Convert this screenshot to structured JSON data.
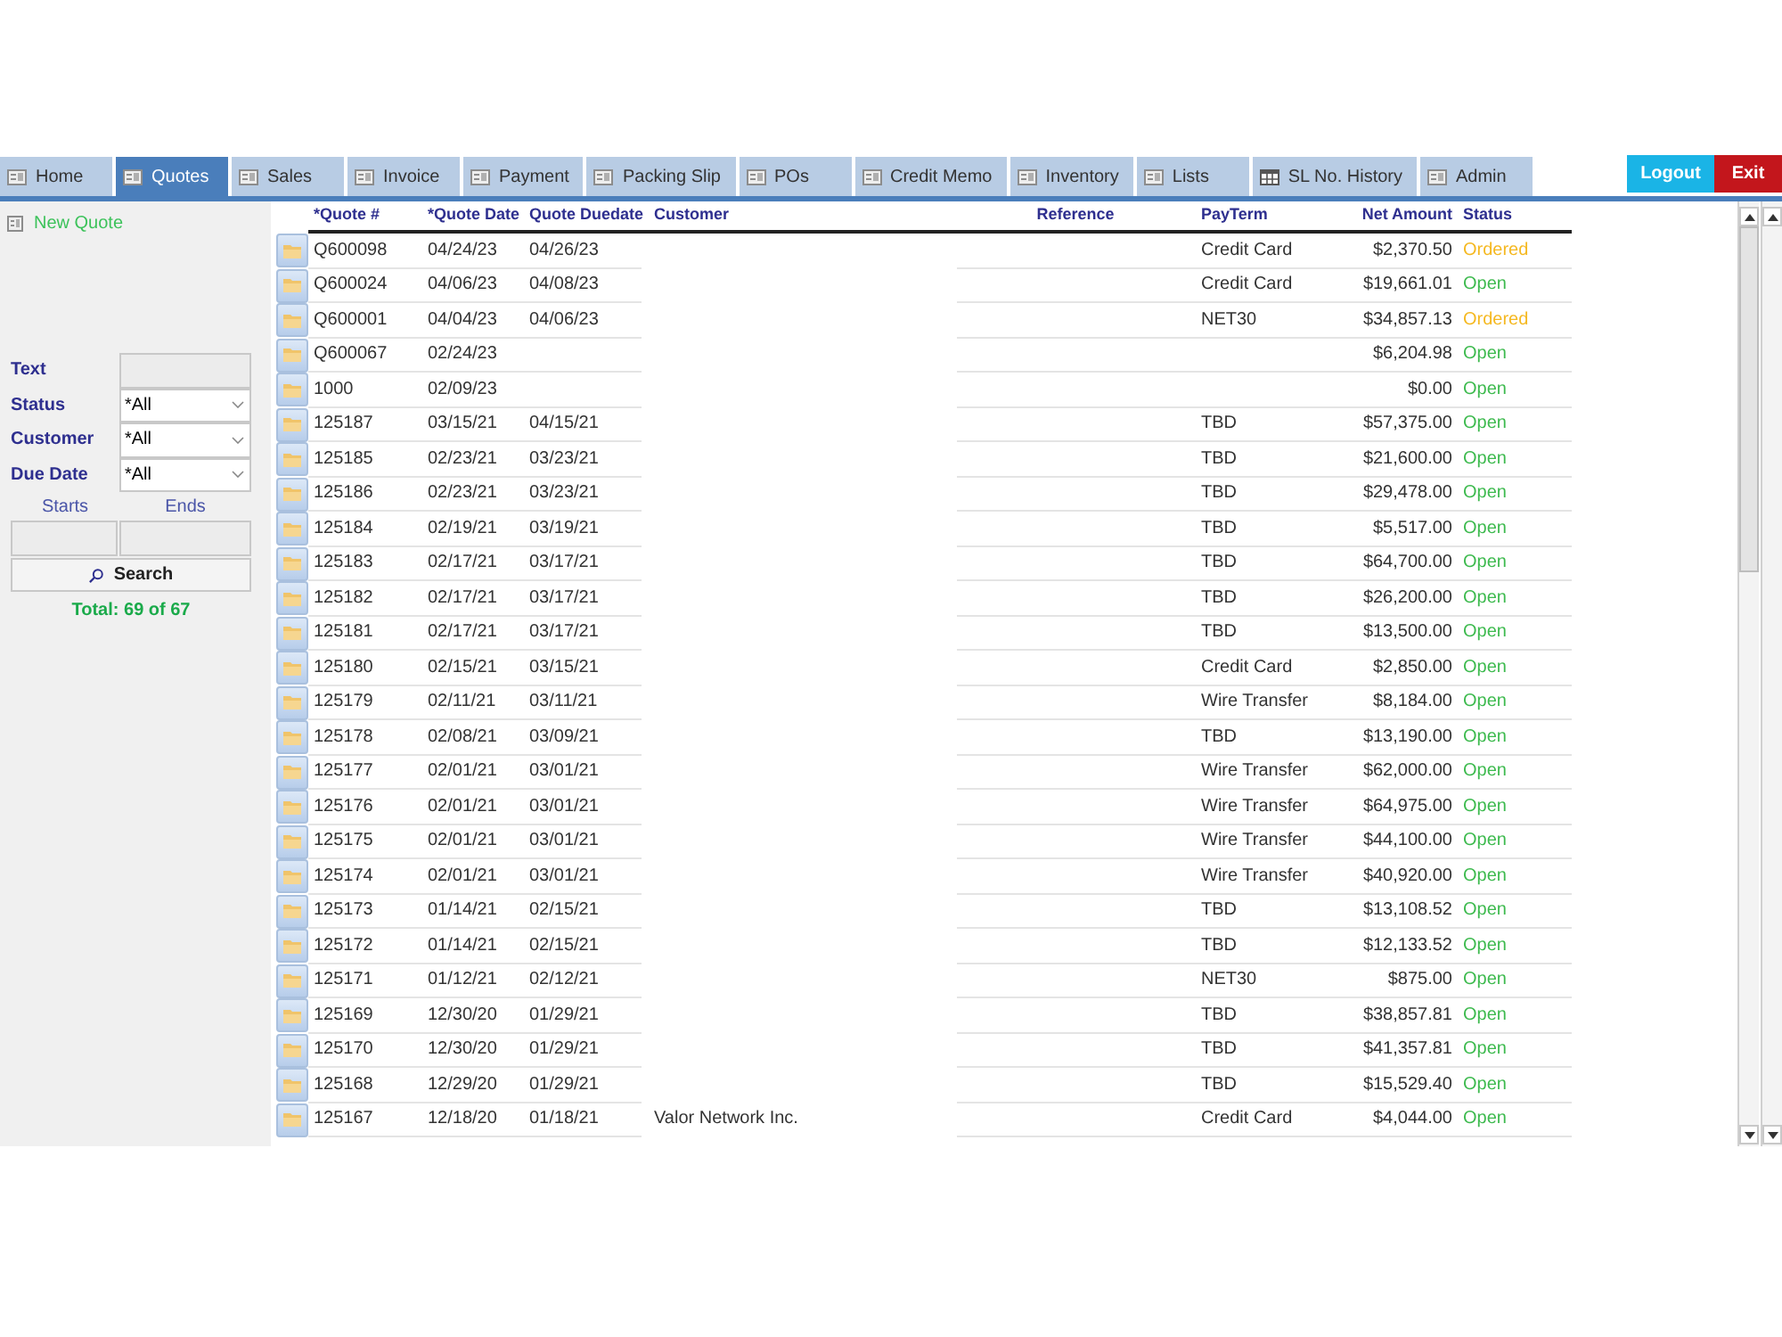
{
  "tabs": [
    {
      "label": "Home",
      "kind": "form",
      "selected": false
    },
    {
      "label": "Quotes",
      "kind": "form",
      "selected": true
    },
    {
      "label": "Sales",
      "kind": "form",
      "selected": false
    },
    {
      "label": "Invoice",
      "kind": "form",
      "selected": false
    },
    {
      "label": "Payment",
      "kind": "form",
      "selected": false
    },
    {
      "label": "Packing Slip",
      "kind": "form",
      "selected": false
    },
    {
      "label": "POs",
      "kind": "form",
      "selected": false
    },
    {
      "label": "Credit Memo",
      "kind": "form",
      "selected": false
    },
    {
      "label": "Inventory",
      "kind": "form",
      "selected": false
    },
    {
      "label": "Lists",
      "kind": "form",
      "selected": false
    },
    {
      "label": "SL No. History",
      "kind": "table",
      "selected": false
    },
    {
      "label": "Admin",
      "kind": "form",
      "selected": false
    }
  ],
  "header_buttons": {
    "logout": "Logout",
    "exit": "Exit"
  },
  "sidebar": {
    "new_quote": "New Quote",
    "filters": [
      {
        "label": "Text",
        "kind": "text"
      },
      {
        "label": "Status",
        "kind": "select",
        "value": "*All"
      },
      {
        "label": "Customer",
        "kind": "select",
        "value": "*All"
      },
      {
        "label": "Due Date",
        "kind": "select",
        "value": "*All"
      }
    ],
    "date_range": {
      "start_label": "Starts",
      "end_label": "Ends"
    },
    "search_button": "Search",
    "total": "Total: 69 of 67"
  },
  "table": {
    "columns": [
      "*Quote #",
      "*Quote Date",
      "Quote Duedate",
      "Customer",
      "Reference",
      "PayTerm",
      "Net Amount",
      "Status"
    ],
    "rows": [
      {
        "quote_no": "Q600098",
        "quote_date": "04/24/23",
        "due_date": "04/26/23",
        "pay_term": "Credit Card",
        "net_amount": "$2,370.50",
        "status": "Ordered",
        "color": "#f5b820"
      },
      {
        "quote_no": "Q600024",
        "quote_date": "04/06/23",
        "due_date": "04/08/23",
        "pay_term": "Credit Card",
        "net_amount": "$19,661.01",
        "status": "Open",
        "color": "#3dba4e"
      },
      {
        "quote_no": "Q600001",
        "quote_date": "04/04/23",
        "due_date": "04/06/23",
        "pay_term": "NET30",
        "net_amount": "$34,857.13",
        "status": "Ordered",
        "color": "#f5b820"
      },
      {
        "quote_no": "Q600067",
        "quote_date": "02/24/23",
        "net_amount": "$6,204.98",
        "status": "Open",
        "color": "#3dba4e"
      },
      {
        "quote_no": "1000",
        "quote_date": "02/09/23",
        "net_amount": "$0.00",
        "status": "Open",
        "color": "#3dba4e"
      },
      {
        "quote_no": "125187",
        "quote_date": "03/15/21",
        "due_date": "04/15/21",
        "pay_term": "TBD",
        "net_amount": "$57,375.00",
        "status": "Open",
        "color": "#3dba4e"
      },
      {
        "quote_no": "125185",
        "quote_date": "02/23/21",
        "due_date": "03/23/21",
        "pay_term": "TBD",
        "net_amount": "$21,600.00",
        "status": "Open",
        "color": "#3dba4e"
      },
      {
        "quote_no": "125186",
        "quote_date": "02/23/21",
        "due_date": "03/23/21",
        "pay_term": "TBD",
        "net_amount": "$29,478.00",
        "status": "Open",
        "color": "#3dba4e"
      },
      {
        "quote_no": "125184",
        "quote_date": "02/19/21",
        "due_date": "03/19/21",
        "pay_term": "TBD",
        "net_amount": "$5,517.00",
        "status": "Open",
        "color": "#3dba4e"
      },
      {
        "quote_no": "125183",
        "quote_date": "02/17/21",
        "due_date": "03/17/21",
        "pay_term": "TBD",
        "net_amount": "$64,700.00",
        "status": "Open",
        "color": "#3dba4e"
      },
      {
        "quote_no": "125182",
        "quote_date": "02/17/21",
        "due_date": "03/17/21",
        "pay_term": "TBD",
        "net_amount": "$26,200.00",
        "status": "Open",
        "color": "#3dba4e"
      },
      {
        "quote_no": "125181",
        "quote_date": "02/17/21",
        "due_date": "03/17/21",
        "pay_term": "TBD",
        "net_amount": "$13,500.00",
        "status": "Open",
        "color": "#3dba4e"
      },
      {
        "quote_no": "125180",
        "quote_date": "02/15/21",
        "due_date": "03/15/21",
        "pay_term": "Credit Card",
        "net_amount": "$2,850.00",
        "status": "Open",
        "color": "#3dba4e"
      },
      {
        "quote_no": "125179",
        "quote_date": "02/11/21",
        "due_date": "03/11/21",
        "pay_term": "Wire Transfer",
        "net_amount": "$8,184.00",
        "status": "Open",
        "color": "#3dba4e"
      },
      {
        "quote_no": "125178",
        "quote_date": "02/08/21",
        "due_date": "03/09/21",
        "pay_term": "TBD",
        "net_amount": "$13,190.00",
        "status": "Open",
        "color": "#3dba4e"
      },
      {
        "quote_no": "125177",
        "quote_date": "02/01/21",
        "due_date": "03/01/21",
        "pay_term": "Wire Transfer",
        "net_amount": "$62,000.00",
        "status": "Open",
        "color": "#3dba4e"
      },
      {
        "quote_no": "125176",
        "quote_date": "02/01/21",
        "due_date": "03/01/21",
        "pay_term": "Wire Transfer",
        "net_amount": "$64,975.00",
        "status": "Open",
        "color": "#3dba4e"
      },
      {
        "quote_no": "125175",
        "quote_date": "02/01/21",
        "due_date": "03/01/21",
        "pay_term": "Wire Transfer",
        "net_amount": "$44,100.00",
        "status": "Open",
        "color": "#3dba4e"
      },
      {
        "quote_no": "125174",
        "quote_date": "02/01/21",
        "due_date": "03/01/21",
        "pay_term": "Wire Transfer",
        "net_amount": "$40,920.00",
        "status": "Open",
        "color": "#3dba4e"
      },
      {
        "quote_no": "125173",
        "quote_date": "01/14/21",
        "due_date": "02/15/21",
        "pay_term": "TBD",
        "net_amount": "$13,108.52",
        "status": "Open",
        "color": "#3dba4e"
      },
      {
        "quote_no": "125172",
        "quote_date": "01/14/21",
        "due_date": "02/15/21",
        "pay_term": "TBD",
        "net_amount": "$12,133.52",
        "status": "Open",
        "color": "#3dba4e"
      },
      {
        "quote_no": "125171",
        "quote_date": "01/12/21",
        "due_date": "02/12/21",
        "pay_term": "NET30",
        "net_amount": "$875.00",
        "status": "Open",
        "color": "#3dba4e"
      },
      {
        "quote_no": "125169",
        "quote_date": "12/30/20",
        "due_date": "01/29/21",
        "pay_term": "TBD",
        "net_amount": "$38,857.81",
        "status": "Open",
        "color": "#3dba4e"
      },
      {
        "quote_no": "125170",
        "quote_date": "12/30/20",
        "due_date": "01/29/21",
        "pay_term": "TBD",
        "net_amount": "$41,357.81",
        "status": "Open",
        "color": "#3dba4e"
      },
      {
        "quote_no": "125168",
        "quote_date": "12/29/20",
        "due_date": "01/29/21",
        "pay_term": "TBD",
        "net_amount": "$15,529.40",
        "status": "Open",
        "color": "#3dba4e"
      },
      {
        "quote_no": "125167",
        "quote_date": "12/18/20",
        "due_date": "01/18/21",
        "customer": "Valor Network Inc.",
        "pay_term": "Credit Card",
        "net_amount": "$4,044.00",
        "status": "Open",
        "color": "#3dba4e"
      }
    ]
  }
}
